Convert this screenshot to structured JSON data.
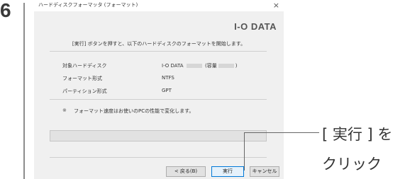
{
  "step": {
    "number": "6"
  },
  "dialog": {
    "title": "ハードディスクフォーマッタ (フォーマット)",
    "close_glyph": "×",
    "logo": "I-O DATA",
    "intro": "[実行] ボタンを押すと、以下のハードディスクのフォーマットを開始します。",
    "info": {
      "target_label": "対象ハードディスク",
      "target_value_prefix": "I-O DATA",
      "target_value_paren_open": "(容量",
      "target_value_paren_close": ")",
      "format_label": "フォーマット形式",
      "format_value": "NTFS",
      "partition_label": "パーティション形式",
      "partition_value": "GPT"
    },
    "note_mark": "※",
    "note": "フォーマット速度はお使いのPCの性能で変化します。",
    "progress_value": 0,
    "buttons": {
      "back": "< 戻る(B)",
      "run": "実行",
      "cancel": "キャンセル"
    }
  },
  "callout": {
    "line1": "[ 実行 ] を",
    "line2": "クリック"
  }
}
